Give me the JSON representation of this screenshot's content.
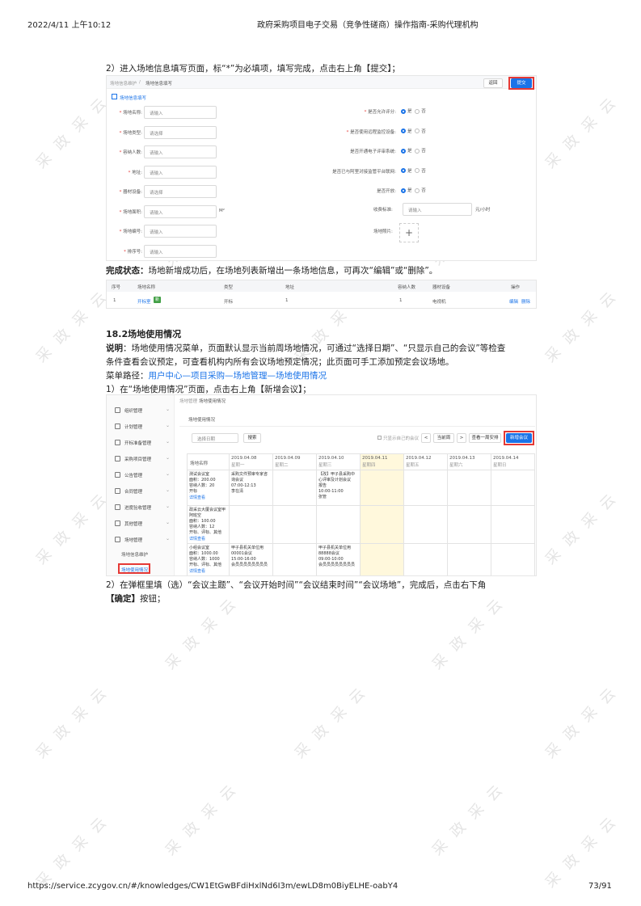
{
  "header": {
    "datetime": "2022/4/11 上午10:12",
    "doc_title": "政府采购项目电子交易（竞争性磋商）操作指南-采购代理机构"
  },
  "step2": {
    "text": "2）进入场地信息填写页面，标“*”为必填项，填写完成，点击右上角【提交】；"
  },
  "form_shot": {
    "breadcrumb1": "场地信息维护",
    "breadcrumb_sep": "/",
    "breadcrumb2": "场地信息填写",
    "btn_back": "返回",
    "btn_submit": "提交",
    "section_title": "场地信息填写",
    "left_fields": [
      {
        "label": "场地名称:",
        "placeholder": "请输入",
        "required": true
      },
      {
        "label": "场地类型:",
        "placeholder": "请选择",
        "required": true
      },
      {
        "label": "容纳人数:",
        "placeholder": "请输入",
        "required": true
      },
      {
        "label": "地址:",
        "placeholder": "请输入",
        "required": true
      },
      {
        "label": "器材设备:",
        "placeholder": "请选择",
        "required": true
      },
      {
        "label": "场地面积:",
        "placeholder": "请输入",
        "required": true,
        "unit": "M²"
      },
      {
        "label": "场地编号:",
        "placeholder": "请输入",
        "required": true
      },
      {
        "label": "排序号:",
        "placeholder": "请输入",
        "required": true
      }
    ],
    "right_fields": [
      {
        "label": "是否允许评分:",
        "required": true,
        "yes": "是",
        "no": "否"
      },
      {
        "label": "是否使用远程监控设备:",
        "required": true,
        "yes": "是",
        "no": "否"
      },
      {
        "label": "是否开通电子评审系统:",
        "required": false,
        "yes": "是",
        "no": "否"
      },
      {
        "label": "是否已与阿里对接监管平台联网:",
        "required": false,
        "yes": "是",
        "no": "否"
      },
      {
        "label": "是否开放:",
        "required": false,
        "yes": "是",
        "no": "否"
      }
    ],
    "fee_label": "收费标准:",
    "fee_placeholder": "请输入",
    "fee_unit": "元/小时",
    "photo_label": "场地照片:",
    "photo_plus": "+"
  },
  "complete": {
    "bold": "完成状态：",
    "text": "场地新增成功后，在场地列表新增出一条场地信息，可再次“编辑”或“删除”。"
  },
  "list_shot": {
    "headers": [
      "序号",
      "场地名称",
      "类型",
      "地址",
      "容纳人数",
      "器材设备",
      "操作"
    ],
    "row": [
      "1",
      "开标室",
      "开标",
      "1",
      "1",
      "电视机"
    ],
    "tag": "新",
    "edit": "编辑",
    "delete": "删除"
  },
  "section18_2": {
    "title": "18.2场地使用情况",
    "desc_bold": "说明",
    "desc_line1": "：场地使用情况菜单，页面默认显示当前周场地情况，可通过“选择日期”、“只显示自己的会议”等检查",
    "desc_line2": "条件查看会议预定，可查看机构内所有会议场地预定情况；此页面可手工添加预定会议场地。",
    "menu_prefix": "菜单路径：",
    "menu_path": "用户中心—项目采购—场地管理—场地使用情况",
    "step1": "1）在“场地使用情况”页面，点击右上角【新增会议】；"
  },
  "cal_shot": {
    "sidebar": [
      "组织管理",
      "计划管理",
      "开标准备管理",
      "采购项目管理",
      "公告管理",
      "合同管理",
      "进度验收管理",
      "其他管理",
      "场地管理"
    ],
    "sub1": "场地信息维护",
    "sub2": "场地使用情况",
    "breadcrumb1": "场地管理",
    "breadcrumb2": "场地使用情况",
    "page_title": "场地使用情况",
    "date_placeholder": "选择日期",
    "btn_search": "搜索",
    "only_mine": "只显示自己的会议",
    "btn_prev": "<",
    "btn_this_week": "当前周",
    "btn_next": ">",
    "btn_last_week": "查看一周安排",
    "btn_new": "新增会议",
    "col_header": "场地名称",
    "days": [
      {
        "date": "2019.04.08",
        "week": "星期一"
      },
      {
        "date": "2019.04.09",
        "week": "星期二"
      },
      {
        "date": "2019.04.10",
        "week": "星期三"
      },
      {
        "date": "2019.04.11",
        "week": "星期四"
      },
      {
        "date": "2019.04.12",
        "week": "星期五"
      },
      {
        "date": "2019.04.13",
        "week": "星期六"
      },
      {
        "date": "2019.04.14",
        "week": "星期日"
      }
    ],
    "rooms": [
      {
        "info": "测试会议室\n面积：200.00\n容纳人数：20\n开标\n",
        "link": "详情查看",
        "mon": "采购文件预审专家咨\n询会议\n07:00-12:13\n李在清",
        "wed": "【改】甲子县采购中\n心评审及计划会议\n报告\n10:00-11:00\n张管"
      },
      {
        "info": "政采云大厦会议室甲\n阿班空\n面积：100.00\n容纳人数：12\n开标、评标、其他\n",
        "link": "详情查看",
        "mon": "",
        "wed": ""
      },
      {
        "info": "小组会议室\n面积：1000.00\n容纳人数：1000\n开标、评标、其他\n",
        "link": "详情查看",
        "mon": "甲子县机关单位用\n00001会议\n15:00-16:00\n会员员员员员员员员",
        "wed": "甲子县机关单位用\n88888会议\n09:00-10:00\n会员员员员员员员员"
      }
    ]
  },
  "step2b": {
    "line1": "2）在弹框里填（选）“会议主题”、“会议开始时间”“会议结束时间”“会议场地”，完成后，点击右下角",
    "bold": "【确定】",
    "line2_rest": "按钮；"
  },
  "footer": {
    "url": "https://service.zcygov.cn/#/knowledges/CW1EtGwBFdiHxlNd6I3m/ewLD8m0BiyELHE-oabY4",
    "page": "73/91"
  },
  "watermark": "采 政 采 云"
}
